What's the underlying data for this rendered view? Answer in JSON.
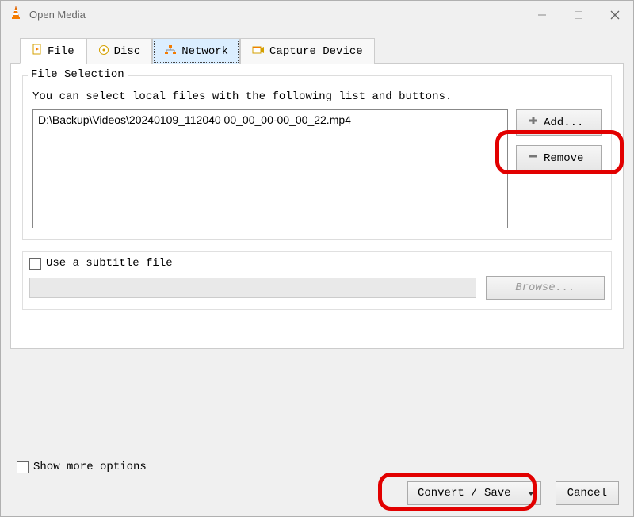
{
  "window": {
    "title": "Open Media"
  },
  "tabs": {
    "file": "File",
    "disc": "Disc",
    "network": "Network",
    "capture": "Capture Device"
  },
  "fileSelection": {
    "title": "File Selection",
    "help": "You can select local files with the following list and buttons.",
    "files": [
      "D:\\Backup\\Videos\\20240109_112040 00_00_00-00_00_22.mp4"
    ],
    "addLabel": "Add...",
    "removeLabel": "Remove"
  },
  "subtitle": {
    "checkboxLabel": "Use a subtitle file",
    "browseLabel": "Browse..."
  },
  "footer": {
    "showMore": "Show more options",
    "convert": "Convert / Save",
    "cancel": "Cancel"
  }
}
